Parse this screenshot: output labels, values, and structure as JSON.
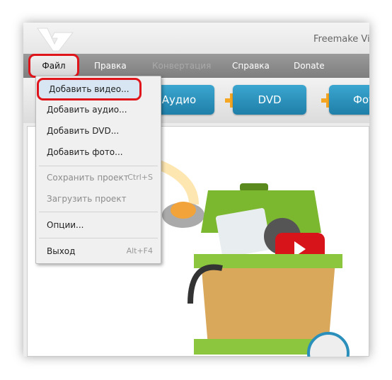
{
  "window": {
    "title": "Freemake Vic"
  },
  "menubar": [
    {
      "label": "Файл",
      "state": "highlighted"
    },
    {
      "label": "Правка"
    },
    {
      "label": "Конвертация",
      "disabled": true
    },
    {
      "label": "Справка"
    },
    {
      "label": "Donate"
    }
  ],
  "toolbar": [
    {
      "label": "Аудио",
      "icon": "plus-icon"
    },
    {
      "label": "DVD",
      "icon": "plus-icon"
    },
    {
      "label": "Фото",
      "icon": "plus-icon"
    }
  ],
  "file_menu": [
    {
      "label": "Добавить видео...",
      "highlighted": true
    },
    {
      "label": "Добавить аудио..."
    },
    {
      "label": "Добавить DVD..."
    },
    {
      "label": "Добавить фото..."
    },
    {
      "label": "Сохранить проект",
      "shortcut": "Ctrl+S",
      "disabled": true
    },
    {
      "label": "Загрузить проект",
      "disabled": true
    },
    {
      "label": "Опции..."
    },
    {
      "label": "Выход",
      "shortcut": "Alt+F4"
    }
  ],
  "colors": {
    "highlight": "#e0141b",
    "button": "#2a8fba",
    "plus": "#f5a623",
    "box": "#7cb82f"
  }
}
